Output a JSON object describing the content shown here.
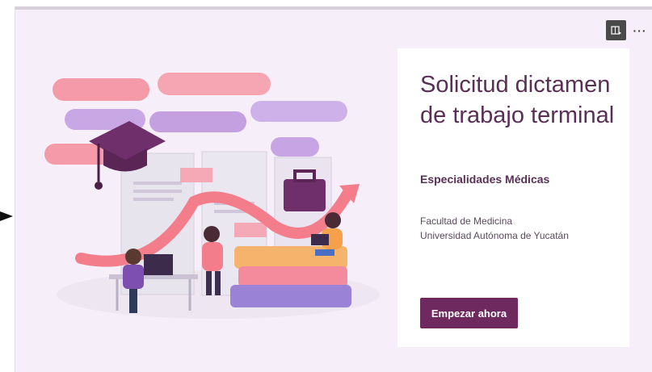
{
  "form": {
    "title": "Solicitud dictamen de trabajo terminal",
    "subtitle": "Especialidades Médicas",
    "organization_line1": "Facultad de Medicina",
    "organization_line2": "Universidad Autónoma de Yucatán",
    "start_button": "Empezar ahora"
  },
  "toolbar": {
    "icons": [
      "immersive-reader-icon",
      "more-options-icon"
    ],
    "more_glyph": "···"
  },
  "colors": {
    "accent": "#6e2a5f",
    "title_text": "#5a2f55",
    "background": "#f6eef8",
    "card": "#ffffff"
  }
}
